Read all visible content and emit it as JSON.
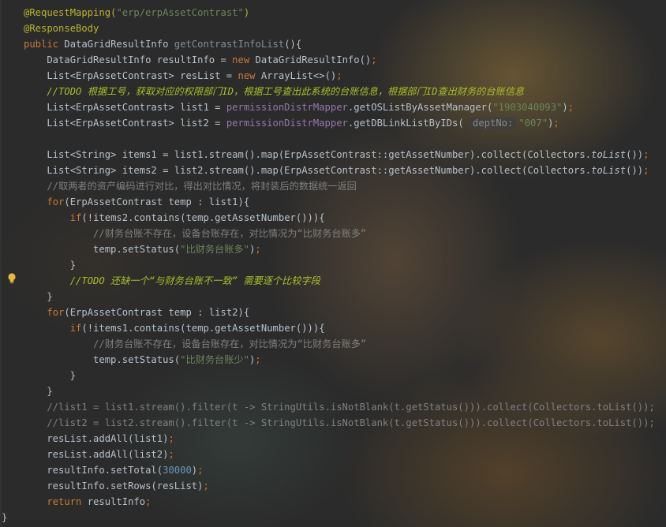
{
  "editor": {
    "hint_dept": "deptNo:",
    "lines": [
      {
        "t": [
          {
            "s": "@RequestMapping(",
            "c": "ann"
          },
          {
            "s": "\"erp/erpAssetContrast\"",
            "c": "str"
          },
          {
            "s": ")",
            "c": "ann"
          }
        ]
      },
      {
        "t": [
          {
            "s": "@ResponseBody",
            "c": "ann"
          }
        ]
      },
      {
        "t": [
          {
            "s": "public ",
            "c": "kw"
          },
          {
            "s": "DataGridResultInfo "
          },
          {
            "s": "getContrastInfoList",
            "c": "dim"
          },
          {
            "s": "(){"
          }
        ]
      },
      {
        "t": [
          {
            "s": "    DataGridResultInfo resultInfo = "
          },
          {
            "s": "new ",
            "c": "kw"
          },
          {
            "s": "DataGridResultInfo()"
          },
          {
            "s": ";",
            "c": "kw"
          }
        ]
      },
      {
        "t": [
          {
            "s": "    List<ErpAssetContrast> resList = "
          },
          {
            "s": "new ",
            "c": "kw"
          },
          {
            "s": "ArrayList<>()"
          },
          {
            "s": ";",
            "c": "kw"
          }
        ]
      },
      {
        "t": [
          {
            "s": "    //TODO 根据工号，获取对应的权限部门ID，根据工号查出此系统的台账信息，根据部门ID查出财务的台账信息",
            "c": "todo"
          }
        ]
      },
      {
        "t": [
          {
            "s": "    List<ErpAssetContrast> list1 = "
          },
          {
            "s": "permissionDistrMapper",
            "c": "purple"
          },
          {
            "s": ".getOSListByAssetManager("
          },
          {
            "s": "\"1903040093\"",
            "c": "str"
          },
          {
            "s": ")"
          },
          {
            "s": ";",
            "c": "kw"
          }
        ]
      },
      {
        "t": [
          {
            "s": "    List<ErpAssetContrast> list2 = "
          },
          {
            "s": "permissionDistrMapper",
            "c": "purple"
          },
          {
            "s": ".getDBLinkListByIDs( "
          },
          {
            "hint": true
          },
          {
            "s": "\"007\"",
            "c": "str"
          },
          {
            "s": ")"
          },
          {
            "s": ";",
            "c": "kw"
          }
        ]
      },
      {
        "t": [
          {
            "s": ""
          }
        ]
      },
      {
        "t": [
          {
            "s": "    List<String> items1 = list1.stream().map(ErpAssetContrast::getAssetNumber).collect(Collectors."
          },
          {
            "s": "toList",
            "c": "ital"
          },
          {
            "s": "())"
          },
          {
            "s": ";",
            "c": "kw"
          }
        ]
      },
      {
        "t": [
          {
            "s": "    List<String> items2 = list2.stream().map(ErpAssetContrast::getAssetNumber).collect(Collectors."
          },
          {
            "s": "toList",
            "c": "ital"
          },
          {
            "s": "())"
          },
          {
            "s": ";",
            "c": "kw"
          }
        ]
      },
      {
        "t": [
          {
            "s": "    //取两者的资产编码进行对比，得出对比情况，将封装后的数据统一返回",
            "c": "cmt"
          }
        ]
      },
      {
        "t": [
          {
            "s": "    "
          },
          {
            "s": "for",
            "c": "kw"
          },
          {
            "s": "(ErpAssetContrast temp : list1){"
          }
        ]
      },
      {
        "t": [
          {
            "s": "        "
          },
          {
            "s": "if",
            "c": "kw"
          },
          {
            "s": "(!items2.contains(temp.getAssetNumber())){"
          }
        ]
      },
      {
        "t": [
          {
            "s": "            //财务台账不存在，设备台账存在，对比情况为“比财务台账多”",
            "c": "cmt"
          }
        ]
      },
      {
        "t": [
          {
            "s": "            temp.setStatus("
          },
          {
            "s": "\"比财务台账多\"",
            "c": "str"
          },
          {
            "s": ")"
          },
          {
            "s": ";",
            "c": "kw"
          }
        ]
      },
      {
        "t": [
          {
            "s": "        }"
          }
        ]
      },
      {
        "t": [
          {
            "s": "        //TODO 还缺一个“与财务台账不一致” 需要逐个比较字段",
            "c": "todo"
          }
        ]
      },
      {
        "t": [
          {
            "s": "    }"
          }
        ]
      },
      {
        "t": [
          {
            "s": "    "
          },
          {
            "s": "for",
            "c": "kw"
          },
          {
            "s": "(ErpAssetContrast temp : list2){"
          }
        ]
      },
      {
        "t": [
          {
            "s": "        "
          },
          {
            "s": "if",
            "c": "kw"
          },
          {
            "s": "(!items1.contains(temp.getAssetNumber())){"
          }
        ]
      },
      {
        "t": [
          {
            "s": "            //财务台账不存在，设备台账存在，对比情况为“比财务台账多”",
            "c": "cmt"
          }
        ]
      },
      {
        "t": [
          {
            "s": "            temp.setStatus("
          },
          {
            "s": "\"比财务台账少\"",
            "c": "str"
          },
          {
            "s": ")"
          },
          {
            "s": ";",
            "c": "kw"
          }
        ]
      },
      {
        "t": [
          {
            "s": "        }"
          }
        ]
      },
      {
        "t": [
          {
            "s": "    }"
          }
        ]
      },
      {
        "t": [
          {
            "s": "    //list1 = list1.stream().filter(t -> StringUtils.isNotBlank(t.getStatus())).collect(Collectors.toList());",
            "c": "cmt"
          }
        ]
      },
      {
        "t": [
          {
            "s": "    //list2 = list2.stream().filter(t -> StringUtils.isNotBlank(t.getStatus())).collect(Collectors.toList());",
            "c": "cmt"
          }
        ]
      },
      {
        "t": [
          {
            "s": "    resList.addAll(list1)"
          },
          {
            "s": ";",
            "c": "kw"
          }
        ]
      },
      {
        "t": [
          {
            "s": "    resList.addAll(list2)"
          },
          {
            "s": ";",
            "c": "kw"
          }
        ]
      },
      {
        "t": [
          {
            "s": "    resultInfo.setTotal("
          },
          {
            "s": "30000",
            "c": "num"
          },
          {
            "s": ")"
          },
          {
            "s": ";",
            "c": "kw"
          }
        ]
      },
      {
        "t": [
          {
            "s": "    resultInfo.setRows(resList)"
          },
          {
            "s": ";",
            "c": "kw"
          }
        ]
      },
      {
        "t": [
          {
            "s": "    "
          },
          {
            "s": "return ",
            "c": "kw"
          },
          {
            "s": "resultInfo"
          },
          {
            "s": ";",
            "c": "kw"
          }
        ]
      },
      {
        "t": [
          {
            "s": "}"
          }
        ],
        "closing": true
      }
    ]
  }
}
